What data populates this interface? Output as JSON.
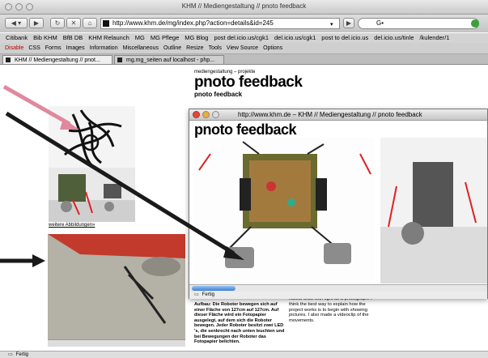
{
  "browser": {
    "window_title": "KHM // Mediengestaltung // pnoto feedback",
    "url": "http://www.khm.de/mg/index.php?action=details&id=245",
    "search_placeholder": "G•",
    "bookmarks": [
      "Citibank",
      "Bib KHM",
      "BfB DB",
      "KHM Relaunch",
      "MG",
      "MG Pflege",
      "MG Blog",
      "post del.icio.us/cgk1",
      "del.icio.us/cgk1",
      "post to del.icio.us",
      "del.icio.us/tinle",
      "/kulender/1"
    ],
    "devtools": [
      "Disable",
      "CSS",
      "Forms",
      "Images",
      "Information",
      "Miscellaneous",
      "Outline",
      "Resize",
      "Tools",
      "View Source",
      "Options"
    ],
    "tabs": [
      {
        "label": "KHM // Mediengestaltung // pnot...",
        "active": true
      },
      {
        "label": "mg.mg_seiten auf localhost - php...",
        "active": false
      }
    ],
    "status": "Fertig"
  },
  "page": {
    "category": "mediengestaltung – projekte",
    "title": "pnoto feedback",
    "subtitle": "pnoto feedback",
    "more_images_link": "weitere Abbildungen»",
    "description_left": "Aufbau: Die Roboter bewegen sich auf einer Fläche von 127cm auf 127cm. Auf dieser Fläche wird ein Fotopapier ausgelegt, auf dem sich die Roboter bewegen. Jeder Roboter besitzt zwei LED 's, die senkrecht nach unten leuchten und bei Bewegungen der Roboter das Fotopapier belichten.",
    "description_right": "robots draw with light as a photograph. I think the best way to explain how the project works is to begin with showing pictures. I also made a videoclip of the movements."
  },
  "popup": {
    "title": "http://www.khm.de – KHM // Mediengestaltung // pnoto feedback",
    "heading": "pnoto feedback",
    "status": "Fertig",
    "scroll_progress": 0.15
  },
  "colors": {
    "annotation_pink": "#e0899e",
    "annotation_dark": "#1a1a1a",
    "scroll_blue": "#3b7fd6"
  },
  "icons": [
    "back-icon",
    "forward-icon",
    "reload-icon",
    "stop-icon",
    "home-icon",
    "go-icon",
    "search-engine-icon"
  ]
}
